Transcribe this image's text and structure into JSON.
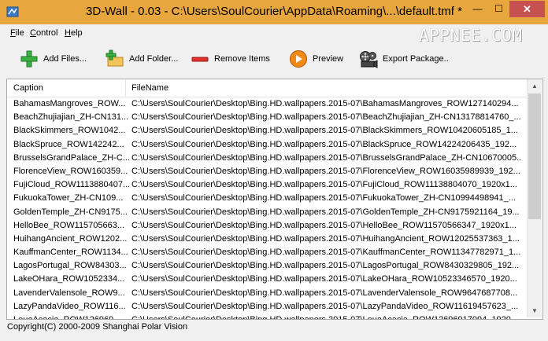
{
  "window": {
    "title": "3D-Wall - 0.03 - C:\\Users\\SoulCourier\\AppData\\Roaming\\...\\default.tmf *",
    "minimize_icon": "minimize-icon",
    "maximize_icon": "maximize-icon",
    "close_icon": "close-icon",
    "minimize_glyph": "—",
    "maximize_glyph": "☐",
    "close_glyph": "✕",
    "titlebar_color": "#e8a63f",
    "close_color": "#c75050"
  },
  "watermark": "APPNEE.COM",
  "menu": [
    {
      "first": "F",
      "rest": "ile"
    },
    {
      "first": "C",
      "rest": "ontrol"
    },
    {
      "first": "H",
      "rest": "elp"
    }
  ],
  "toolbar": {
    "add_files": "Add Files...",
    "add_folder": "Add Folder...",
    "remove_items": "Remove Items",
    "preview": "Preview",
    "export_package": "Export Package.."
  },
  "list": {
    "columns": [
      "Caption",
      "FileName"
    ],
    "rows": [
      [
        "BahamasMangroves_ROW...",
        "C:\\Users\\SoulCourier\\Desktop\\Bing.HD.wallpapers.2015-07\\BahamasMangroves_ROW127140294..."
      ],
      [
        "BeachZhujiajian_ZH-CN131...",
        "C:\\Users\\SoulCourier\\Desktop\\Bing.HD.wallpapers.2015-07\\BeachZhujiajian_ZH-CN13178814760_..."
      ],
      [
        "BlackSkimmers_ROW1042...",
        "C:\\Users\\SoulCourier\\Desktop\\Bing.HD.wallpapers.2015-07\\BlackSkimmers_ROW10420605185_1..."
      ],
      [
        "BlackSpruce_ROW142242...",
        "C:\\Users\\SoulCourier\\Desktop\\Bing.HD.wallpapers.2015-07\\BlackSpruce_ROW14224206435_192..."
      ],
      [
        "BrusselsGrandPalace_ZH-C...",
        "C:\\Users\\SoulCourier\\Desktop\\Bing.HD.wallpapers.2015-07\\BrusselsGrandPalace_ZH-CN10670005..."
      ],
      [
        "FlorenceView_ROW160359...",
        "C:\\Users\\SoulCourier\\Desktop\\Bing.HD.wallpapers.2015-07\\FlorenceView_ROW16035989939_192..."
      ],
      [
        "FujiCloud_ROW1113880407...",
        "C:\\Users\\SoulCourier\\Desktop\\Bing.HD.wallpapers.2015-07\\FujiCloud_ROW11138804070_1920x1..."
      ],
      [
        "FukuokaTower_ZH-CN109...",
        "C:\\Users\\SoulCourier\\Desktop\\Bing.HD.wallpapers.2015-07\\FukuokaTower_ZH-CN10994498941_..."
      ],
      [
        "GoldenTemple_ZH-CN9175...",
        "C:\\Users\\SoulCourier\\Desktop\\Bing.HD.wallpapers.2015-07\\GoldenTemple_ZH-CN9175921164_19..."
      ],
      [
        "HelloBee_ROW115705663...",
        "C:\\Users\\SoulCourier\\Desktop\\Bing.HD.wallpapers.2015-07\\HelloBee_ROW11570566347_1920x1..."
      ],
      [
        "HuihangAncient_ROW1202...",
        "C:\\Users\\SoulCourier\\Desktop\\Bing.HD.wallpapers.2015-07\\HuihangAncient_ROW12025537363_1..."
      ],
      [
        "KauffmanCenter_ROW1134...",
        "C:\\Users\\SoulCourier\\Desktop\\Bing.HD.wallpapers.2015-07\\KauffmanCenter_ROW11347782971_1..."
      ],
      [
        "LagosPortugal_ROW84303...",
        "C:\\Users\\SoulCourier\\Desktop\\Bing.HD.wallpapers.2015-07\\LagosPortugal_ROW8430329805_192..."
      ],
      [
        "LakeOHara_ROW1052334...",
        "C:\\Users\\SoulCourier\\Desktop\\Bing.HD.wallpapers.2015-07\\LakeOHara_ROW10523346570_1920..."
      ],
      [
        "LavenderValensole_ROW9...",
        "C:\\Users\\SoulCourier\\Desktop\\Bing.HD.wallpapers.2015-07\\LavenderValensole_ROW9647687708..."
      ],
      [
        "LazyPandaVideo_ROW116...",
        "C:\\Users\\SoulCourier\\Desktop\\Bing.HD.wallpapers.2015-07\\LazyPandaVideo_ROW11619457623_..."
      ],
      [
        "LeuaAcacia_ROW126969...",
        "C:\\Users\\SoulCourier\\Desktop\\Bing.HD.wallpapers.2015-07\\LeuaAcacia_ROW12696917094_1920..."
      ]
    ]
  },
  "status": "Copyright(C) 2000-2009 Shanghai Polar Vision"
}
